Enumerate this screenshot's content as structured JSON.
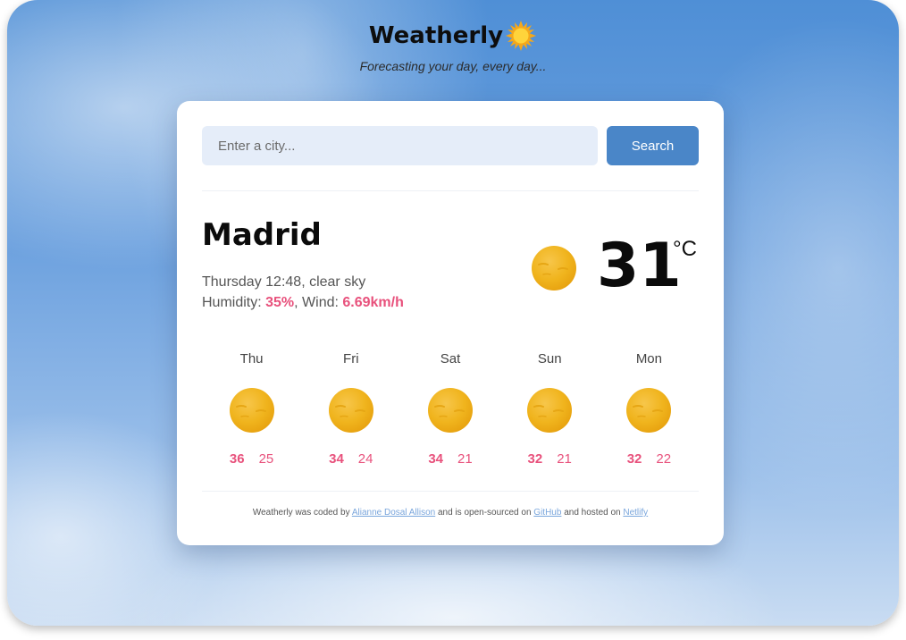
{
  "brand": {
    "title": "Weatherly",
    "icon": "sun-emoji-icon",
    "tagline": "Forecasting your day, every day..."
  },
  "search": {
    "placeholder": "Enter a city...",
    "value": "",
    "button_label": "Search"
  },
  "current": {
    "city": "Madrid",
    "day_time": "Thursday 12:48",
    "description": "clear sky",
    "humidity_label": "Humidity: ",
    "humidity_value": "35%",
    "wind_label": "Wind: ",
    "wind_value": "6.69km/h",
    "temperature": "31",
    "unit": "°C",
    "icon": "sun-icon"
  },
  "forecast": [
    {
      "day": "Thu",
      "max": "36",
      "min": "25",
      "icon": "sun-icon"
    },
    {
      "day": "Fri",
      "max": "34",
      "min": "24",
      "icon": "sun-icon"
    },
    {
      "day": "Sat",
      "max": "34",
      "min": "21",
      "icon": "sun-icon"
    },
    {
      "day": "Sun",
      "max": "32",
      "min": "21",
      "icon": "sun-icon"
    },
    {
      "day": "Mon",
      "max": "32",
      "min": "22",
      "icon": "sun-icon"
    }
  ],
  "footer": {
    "text_1": "Weatherly was coded by ",
    "author_link": "Alianne Dosal Allison",
    "text_2": " and is open-sourced on ",
    "github_link": "GitHub",
    "text_3": " and hosted on ",
    "netlify_link": "Netlify"
  },
  "colors": {
    "accent": "#e8517c",
    "button": "#4a86c8",
    "input_bg": "#e5edf9",
    "link": "#7aa6dc",
    "sun": "#f2b51c"
  }
}
